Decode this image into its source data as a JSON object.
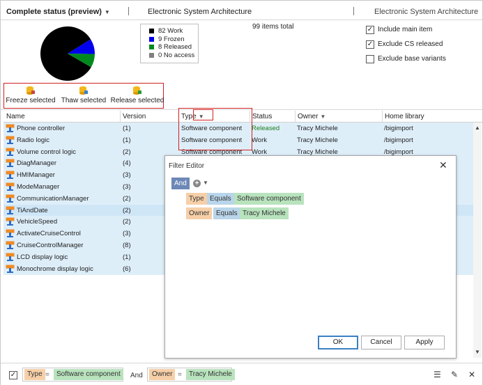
{
  "header": {
    "title": "Complete status (preview)",
    "center_text": "Electronic System Architecture",
    "right_text": "Electronic System Architecture"
  },
  "summary": {
    "items_total": "99 items total",
    "pie": [
      {
        "label": "Work",
        "value": 82,
        "color": "#000000"
      },
      {
        "label": "Frozen",
        "value": 9,
        "color": "#0000ee"
      },
      {
        "label": "Released",
        "value": 8,
        "color": "#008a1e"
      },
      {
        "label": "No access",
        "value": 0,
        "color": "#808080"
      }
    ],
    "legend": [
      "82 Work",
      "9 Frozen",
      "8 Released",
      "0 No access"
    ],
    "options": [
      {
        "label": "Include main item",
        "checked": true
      },
      {
        "label": "Exclude CS released",
        "checked": true
      },
      {
        "label": "Exclude base variants",
        "checked": false
      }
    ]
  },
  "toolbar": {
    "freeze_label": "Freeze selected",
    "thaw_label": "Thaw selected",
    "release_label": "Release selected"
  },
  "table": {
    "columns": [
      "Name",
      "Version",
      "Type",
      "Status",
      "Owner",
      "Home library"
    ],
    "rows": [
      {
        "name": "Phone controller",
        "version": "(1)",
        "type": "Software component",
        "status": "Released",
        "owner": "Tracy Michele",
        "library": "/bigimport"
      },
      {
        "name": "Radio logic",
        "version": "(1)",
        "type": "Software component",
        "status": "Work",
        "owner": "Tracy Michele",
        "library": "/bigimport"
      },
      {
        "name": "Volume control logic",
        "version": "(2)",
        "type": "Software component",
        "status": "Work",
        "owner": "Tracy Michele",
        "library": "/bigimport"
      },
      {
        "name": "DiagManager",
        "version": "(4)",
        "type": "",
        "status": "",
        "owner": "",
        "library": ""
      },
      {
        "name": "HMIManager",
        "version": "(3)",
        "type": "",
        "status": "",
        "owner": "",
        "library": ""
      },
      {
        "name": "ModeManager",
        "version": "(3)",
        "type": "",
        "status": "",
        "owner": "",
        "library": ""
      },
      {
        "name": "CommunicationManager",
        "version": "(2)",
        "type": "",
        "status": "",
        "owner": "",
        "library": ""
      },
      {
        "name": "TiAndDate",
        "version": "(2)",
        "type": "",
        "status": "",
        "owner": "",
        "library": ""
      },
      {
        "name": "VehicleSpeed",
        "version": "(2)",
        "type": "",
        "status": "",
        "owner": "",
        "library": ""
      },
      {
        "name": "ActivateCruiseControl",
        "version": "(3)",
        "type": "",
        "status": "",
        "owner": "",
        "library": ""
      },
      {
        "name": "CruiseControlManager",
        "version": "(8)",
        "type": "",
        "status": "",
        "owner": "",
        "library": ""
      },
      {
        "name": "LCD display logic",
        "version": "(1)",
        "type": "",
        "status": "",
        "owner": "",
        "library": ""
      },
      {
        "name": "Monochrome display logic",
        "version": "(6)",
        "type": "",
        "status": "",
        "owner": "",
        "library": ""
      }
    ]
  },
  "filter_editor": {
    "title": "Filter Editor",
    "group": "And",
    "conditions": [
      {
        "field": "Type",
        "op": "Equals",
        "value": "Software component"
      },
      {
        "field": "Owner",
        "op": "Equals",
        "value": "Tracy Michele"
      }
    ],
    "ok": "OK",
    "cancel": "Cancel",
    "apply": "Apply"
  },
  "filter_bar": {
    "field1": "Type",
    "eq1": "=",
    "value1": "Software component",
    "and": "And",
    "field2": "Owner",
    "eq2": "=",
    "value2": "Tracy Michele"
  }
}
